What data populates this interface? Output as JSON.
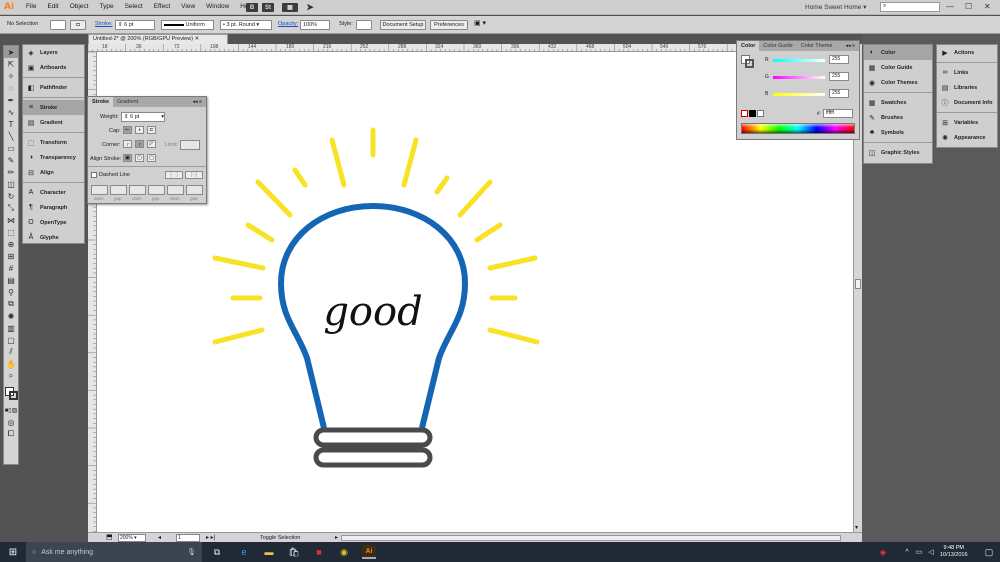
{
  "app": {
    "logo": "Ai",
    "menus": [
      "File",
      "Edit",
      "Object",
      "Type",
      "Select",
      "Effect",
      "View",
      "Window",
      "Help"
    ],
    "workspace": "Home Sweet Home",
    "search_placeholder": ""
  },
  "control_bar": {
    "selection_label": "No Selection",
    "stroke_label": "Stroke:",
    "stroke_weight": "6 pt",
    "profile": "Uniform",
    "brush": "3 pt. Round",
    "opacity_label": "Opacity:",
    "opacity_value": "100%",
    "style_label": "Style:",
    "document_setup": "Document Setup",
    "preferences": "Preferences"
  },
  "document": {
    "tab_title": "Untitled-2* @ 200% (RGB/GPU Preview)",
    "ruler_ticks": [
      "0",
      "18",
      "36",
      "72",
      "108",
      "144",
      "180",
      "216",
      "252",
      "288",
      "324",
      "360",
      "396",
      "432",
      "468",
      "504",
      "540",
      "576"
    ],
    "zoom": "200%",
    "page": "1",
    "status": "Toggle Selection",
    "artwork_word": "good"
  },
  "left_panels": {
    "items": [
      {
        "label": "Layers",
        "icon": "layers-icon"
      },
      {
        "label": "Artboards",
        "icon": "artboards-icon"
      },
      {
        "label": "Pathfinder",
        "icon": "pathfinder-icon"
      },
      {
        "label": "Stroke",
        "icon": "stroke-icon"
      },
      {
        "label": "Gradient",
        "icon": "gradient-icon"
      },
      {
        "label": "Transform",
        "icon": "transform-icon"
      },
      {
        "label": "Transparency",
        "icon": "transparency-icon"
      },
      {
        "label": "Align",
        "icon": "align-icon"
      },
      {
        "label": "Character",
        "icon": "character-icon"
      },
      {
        "label": "Paragraph",
        "icon": "paragraph-icon"
      },
      {
        "label": "OpenType",
        "icon": "opentype-icon"
      },
      {
        "label": "Glyphs",
        "icon": "glyphs-icon"
      }
    ]
  },
  "stroke_panel": {
    "tabs": [
      "Stroke",
      "Gradient"
    ],
    "weight_label": "Weight:",
    "weight_value": "6 pt",
    "cap_label": "Cap:",
    "corner_label": "Corner:",
    "limit_label": "Limit:",
    "align_label": "Align Stroke:",
    "dashed_label": "Dashed Line",
    "dash_labels": [
      "dash",
      "gap",
      "dash",
      "gap",
      "dash",
      "gap"
    ]
  },
  "color_panel": {
    "tabs": [
      "Color",
      "Color Guide",
      "Color Theme"
    ],
    "r_label": "R",
    "g_label": "G",
    "b_label": "B",
    "r": "255",
    "g": "255",
    "b": "255",
    "hex_label": "#",
    "hex": "ffffff"
  },
  "right_panels": {
    "col1": [
      {
        "label": "Color",
        "icon": "color-icon"
      },
      {
        "label": "Color Guide",
        "icon": "color-guide-icon"
      },
      {
        "label": "Color Themes",
        "icon": "color-themes-icon"
      },
      {
        "label": "Swatches",
        "icon": "swatches-icon"
      },
      {
        "label": "Brushes",
        "icon": "brushes-icon"
      },
      {
        "label": "Symbols",
        "icon": "symbols-icon"
      },
      {
        "label": "Graphic Styles",
        "icon": "graphic-styles-icon"
      }
    ],
    "col2": [
      {
        "label": "Actions",
        "icon": "actions-icon"
      },
      {
        "label": "Links",
        "icon": "links-icon"
      },
      {
        "label": "Libraries",
        "icon": "libraries-icon"
      },
      {
        "label": "Document Info",
        "icon": "document-info-icon"
      },
      {
        "label": "Variables",
        "icon": "variables-icon"
      },
      {
        "label": "Appearance",
        "icon": "appearance-icon"
      }
    ]
  },
  "taskbar": {
    "search_placeholder": "Ask me anything",
    "time": "9:48 PM",
    "date": "10/13/2016"
  },
  "colors": {
    "bulb_blue": "#1565b5",
    "rays_yellow": "#f7e224",
    "base_gray": "#4a4a4a",
    "accent": "#ff7f18"
  }
}
